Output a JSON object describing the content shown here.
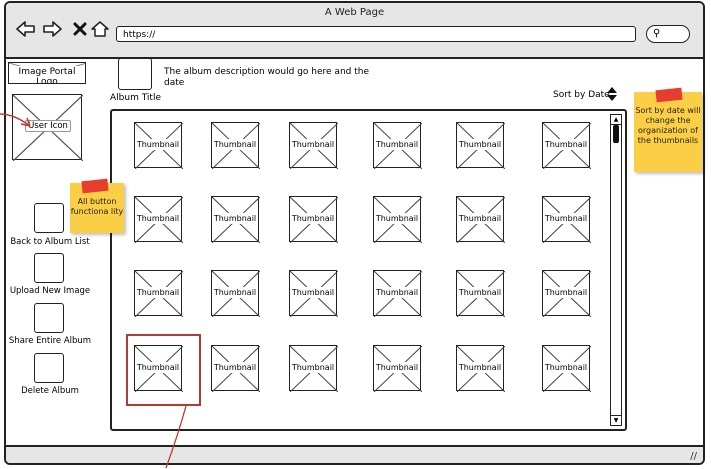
{
  "window": {
    "title": "A Web Page",
    "url": "https://"
  },
  "brand": {
    "logo_label": "Image Portal Logo",
    "user_label": "User Icon"
  },
  "album": {
    "title": "Album Title",
    "description": "The album description would go here and the date",
    "sort_label": "Sort by Date"
  },
  "sidebar": {
    "buttons": [
      {
        "label": "Back to Album List"
      },
      {
        "label": "Upload New Image"
      },
      {
        "label": "Share Entire Album"
      },
      {
        "label": "Delete Album"
      }
    ]
  },
  "grid": {
    "thumbnail_label": "Thumbnail",
    "rows": 4,
    "columns": 6
  },
  "notes": {
    "buttons_note": "All button functiona lity",
    "sort_note": "Sort by date will change the organization of the thumbnails"
  },
  "colors": {
    "sticky": "#fbcf45",
    "tape": "#e63d2e",
    "highlight": "#b23a2e"
  }
}
